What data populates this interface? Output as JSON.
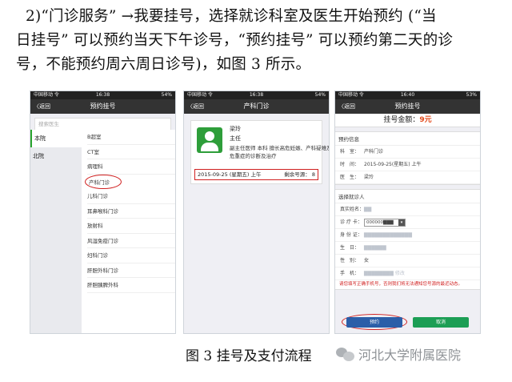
{
  "paragraph": {
    "line1": "2)“门诊服务” →我要挂号，选择就诊科室及医生开始预约 (“当",
    "line2": "日挂号” 可以预约当天下午诊号，“预约挂号” 可以预约第二天的诊",
    "line3": "号，不能预约周六周日诊号)，如图 3 所示。"
  },
  "phone1": {
    "status_left": "中国移动 令",
    "time": "16:38",
    "status_right": "54%",
    "back": "〈返回",
    "title": "预约挂号",
    "search_placeholder": "搜索医生",
    "campuses": [
      "本院",
      "北院"
    ],
    "departments": [
      "B超室",
      "CT室",
      "病理科",
      "产科门诊",
      "儿科门诊",
      "耳鼻喉科门诊",
      "放射科",
      "风湿免疫门诊",
      "妇科门诊",
      "肝胆外科门诊",
      "肝胆胰脾外科"
    ]
  },
  "phone2": {
    "status_left": "中国移动 令",
    "time": "16:38",
    "status_right": "54%",
    "back": "〈返回",
    "title": "产科门诊",
    "doctor_name": "梁玲",
    "doctor_title": "主任",
    "doctor_desc": "副主任医师 本科 擅长高危妊娠、产科疑难及危重症的诊断及治疗",
    "slot_date": "2015-09-25 (星期五) 上午",
    "slot_remaining": "剩余号源： 8"
  },
  "phone3": {
    "status_left": "中国移动 令",
    "time": "16:40",
    "status_right": "53%",
    "back": "〈返回",
    "title": "预约挂号",
    "fee_label": "挂号金额：",
    "fee_value": "9元",
    "info_header": "预约信息",
    "info_rows": [
      {
        "k": "科　室：",
        "v": "产科门诊"
      },
      {
        "k": "时　间：",
        "v": "2015-09-25(星期五) 上午"
      },
      {
        "k": "医　生：",
        "v": "梁玲"
      }
    ],
    "patient_header": "选择就诊人",
    "patient_rows": [
      {
        "k": "真实姓名：",
        "v": "▇▇"
      },
      {
        "k": "诊 疗 卡：",
        "v": "000000▇▇▇"
      },
      {
        "k": "身 份 证：",
        "v": "▇▇▇▇▇▇▇▇▇▇▇▇▇"
      },
      {
        "k": "生　日：",
        "v": "▇▇▇▇▇▇"
      },
      {
        "k": "性　别：",
        "v": "女"
      },
      {
        "k": "手　机：",
        "v": "▇▇▇▇▇▇▇▇ 修改"
      }
    ],
    "warning": "请您填写正确手机号，否则我们将无法通知您号源的最近动态。",
    "confirm": "预约",
    "cancel": "取消"
  },
  "caption": "图 3 挂号及支付流程",
  "watermark": "河北大学附属医院"
}
